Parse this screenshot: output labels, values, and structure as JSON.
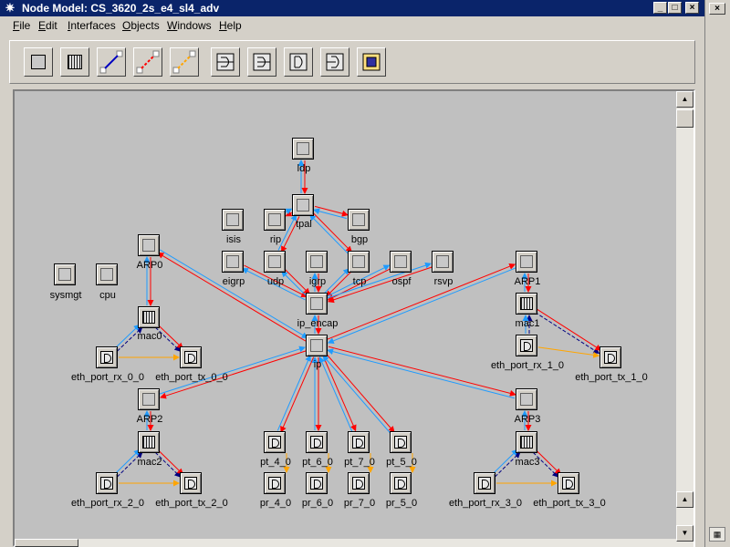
{
  "window": {
    "title": "Node Model: CS_3620_2s_e4_sl4_adv",
    "icon": "app-star-icon",
    "buttons": [
      "_",
      "□",
      "×"
    ]
  },
  "menu": [
    {
      "label": "File",
      "u": "F"
    },
    {
      "label": "Edit",
      "u": "E"
    },
    {
      "label": "Interfaces",
      "u": "I"
    },
    {
      "label": "Objects",
      "u": "O"
    },
    {
      "label": "Windows",
      "u": "W"
    },
    {
      "label": "Help",
      "u": "H"
    }
  ],
  "toolbar": {
    "buttons": [
      "create-processor-icon",
      "create-queue-icon",
      "create-packet-stream-icon",
      "create-statwire-icon",
      "create-logical-association-icon",
      "create-point-to-point-receiver-icon",
      "create-point-to-point-transmitter-icon",
      "create-bus-receiver-icon",
      "create-bus-transmitter-icon",
      "create-antenna-icon"
    ]
  },
  "nodes": {
    "ldp": "ldp",
    "tpal": "tpal",
    "isis": "isis",
    "rip": "rip",
    "bgp": "bgp",
    "eigrp": "eigrp",
    "udp": "udp",
    "igrp": "igrp",
    "tcp": "tcp",
    "ospf": "ospf",
    "rsvp": "rsvp",
    "ip_encap": "ip_encap",
    "ip": "ip",
    "sysmgt": "sysmgt",
    "cpu": "cpu",
    "ARP0": "ARP0",
    "mac0": "mac0",
    "eth_port_rx_0_0": "eth_port_rx_0_0",
    "eth_port_tx_0_0": "eth_port_tx_0_0",
    "ARP1": "ARP1",
    "mac1": "mac1",
    "eth_port_rx_1_0": "eth_port_rx_1_0",
    "eth_port_tx_1_0": "eth_port_tx_1_0",
    "ARP2": "ARP2",
    "mac2": "mac2",
    "eth_port_rx_2_0": "eth_port_rx_2_0",
    "eth_port_tx_2_0": "eth_port_tx_2_0",
    "ARP3": "ARP3",
    "mac3": "mac3",
    "eth_port_rx_3_0": "eth_port_rx_3_0",
    "eth_port_tx_3_0": "eth_port_tx_3_0",
    "pt_4_0": "pt_4_0",
    "pt_6_0": "pt_6_0",
    "pt_7_0": "pt_7_0",
    "pt_5_0": "pt_5_0",
    "pr_4_0": "pr_4_0",
    "pr_6_0": "pr_6_0",
    "pr_7_0": "pr_7_0",
    "pr_5_0": "pr_5_0"
  },
  "colors": {
    "stream_out": "#ff0000",
    "stream_in": "#1e9bff",
    "statwire": "#ffa500",
    "association": "#000080",
    "canvas": "#c0c0c0",
    "titlebar": "#0a246a"
  }
}
